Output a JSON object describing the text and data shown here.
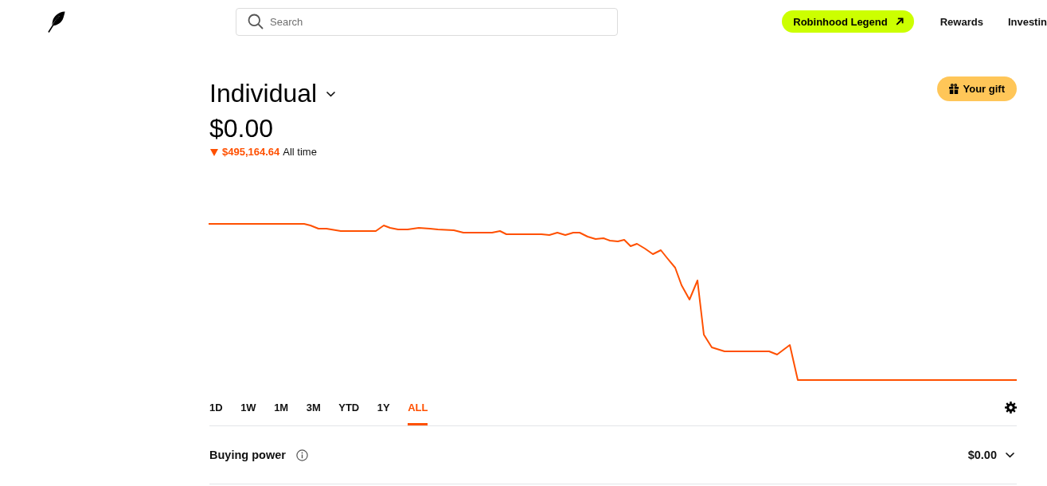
{
  "header": {
    "search": {
      "placeholder": "Search"
    },
    "legend_button": {
      "label": "Robinhood Legend"
    },
    "nav_links": [
      {
        "label": "Rewards"
      },
      {
        "label": "Investin"
      }
    ]
  },
  "account": {
    "name": "Individual",
    "value": "$0.00",
    "change": {
      "negative": true,
      "amount": "$495,164.64",
      "period": "All time"
    },
    "gift_button": {
      "label": "Your gift"
    }
  },
  "ranges": [
    {
      "label": "1D",
      "selected": false
    },
    {
      "label": "1W",
      "selected": false
    },
    {
      "label": "1M",
      "selected": false
    },
    {
      "label": "3M",
      "selected": false
    },
    {
      "label": "YTD",
      "selected": false
    },
    {
      "label": "1Y",
      "selected": false
    },
    {
      "label": "ALL",
      "selected": true
    }
  ],
  "buying_power": {
    "label": "Buying power",
    "value": "$0.00",
    "expanded": false
  }
}
